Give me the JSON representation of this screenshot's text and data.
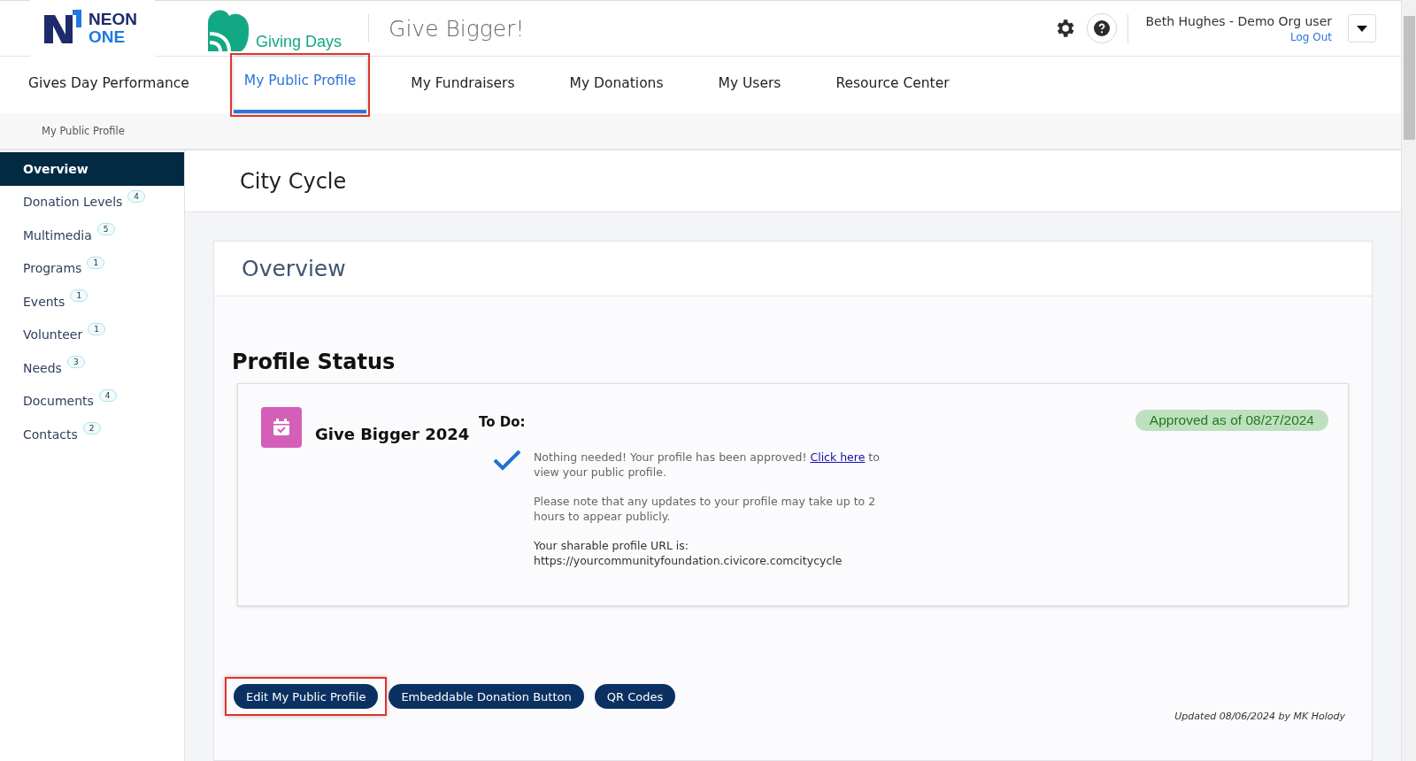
{
  "header": {
    "brand": {
      "line_1": "NEON",
      "line_2": "ONE"
    },
    "product": "Giving Days",
    "site_title": "Give Bigger!",
    "user": {
      "name": "Beth Hughes - Demo Org user",
      "logout": "Log Out"
    }
  },
  "tabs": [
    {
      "label": "Gives Day Performance",
      "selected": false,
      "highlighted": false
    },
    {
      "label": "My Public Profile",
      "selected": true,
      "highlighted": true
    },
    {
      "label": "My Fundraisers",
      "selected": false,
      "highlighted": false
    },
    {
      "label": "My Donations",
      "selected": false,
      "highlighted": false
    },
    {
      "label": "My Users",
      "selected": false,
      "highlighted": false
    },
    {
      "label": "Resource Center",
      "selected": false,
      "highlighted": false
    }
  ],
  "breadcrumb": "My Public Profile",
  "sidebar": {
    "items": [
      {
        "label": "Overview",
        "selected": true
      },
      {
        "label": "Donation Levels",
        "count": "4",
        "selected": false
      },
      {
        "label": "Multimedia",
        "count": "5",
        "selected": false
      },
      {
        "label": "Programs",
        "count": "1",
        "selected": false
      },
      {
        "label": "Events",
        "count": "1",
        "selected": false
      },
      {
        "label": "Volunteer",
        "count": "1",
        "selected": false
      },
      {
        "label": "Needs",
        "count": "3",
        "selected": false
      },
      {
        "label": "Documents",
        "count": "4",
        "selected": false
      },
      {
        "label": "Contacts",
        "count": "2",
        "selected": false
      }
    ]
  },
  "page_title": "City Cycle",
  "card": {
    "title": "Overview",
    "section_title": "Profile Status",
    "status": {
      "event": "Give Bigger 2024",
      "todo_label": "To Do:",
      "badge": "Approved as of 08/27/2024",
      "message_before": "Nothing needed! Your profile has been approved!",
      "link": "Click here",
      "message_after": "to view your public profile.",
      "note": "Please note that any updates to your profile may take up to 2 hours to appear publicly.",
      "url_label": "Your sharable profile URL is:",
      "url": "https://yourcommunityfoundation.civicore.comcitycycle"
    },
    "buttons": [
      {
        "label": "Edit My Public Profile",
        "highlighted": true
      },
      {
        "label": "Embeddable Donation Button",
        "highlighted": false
      },
      {
        "label": "QR Codes",
        "highlighted": false
      }
    ],
    "updated": "Updated 08/06/2024 by MK Holody"
  }
}
